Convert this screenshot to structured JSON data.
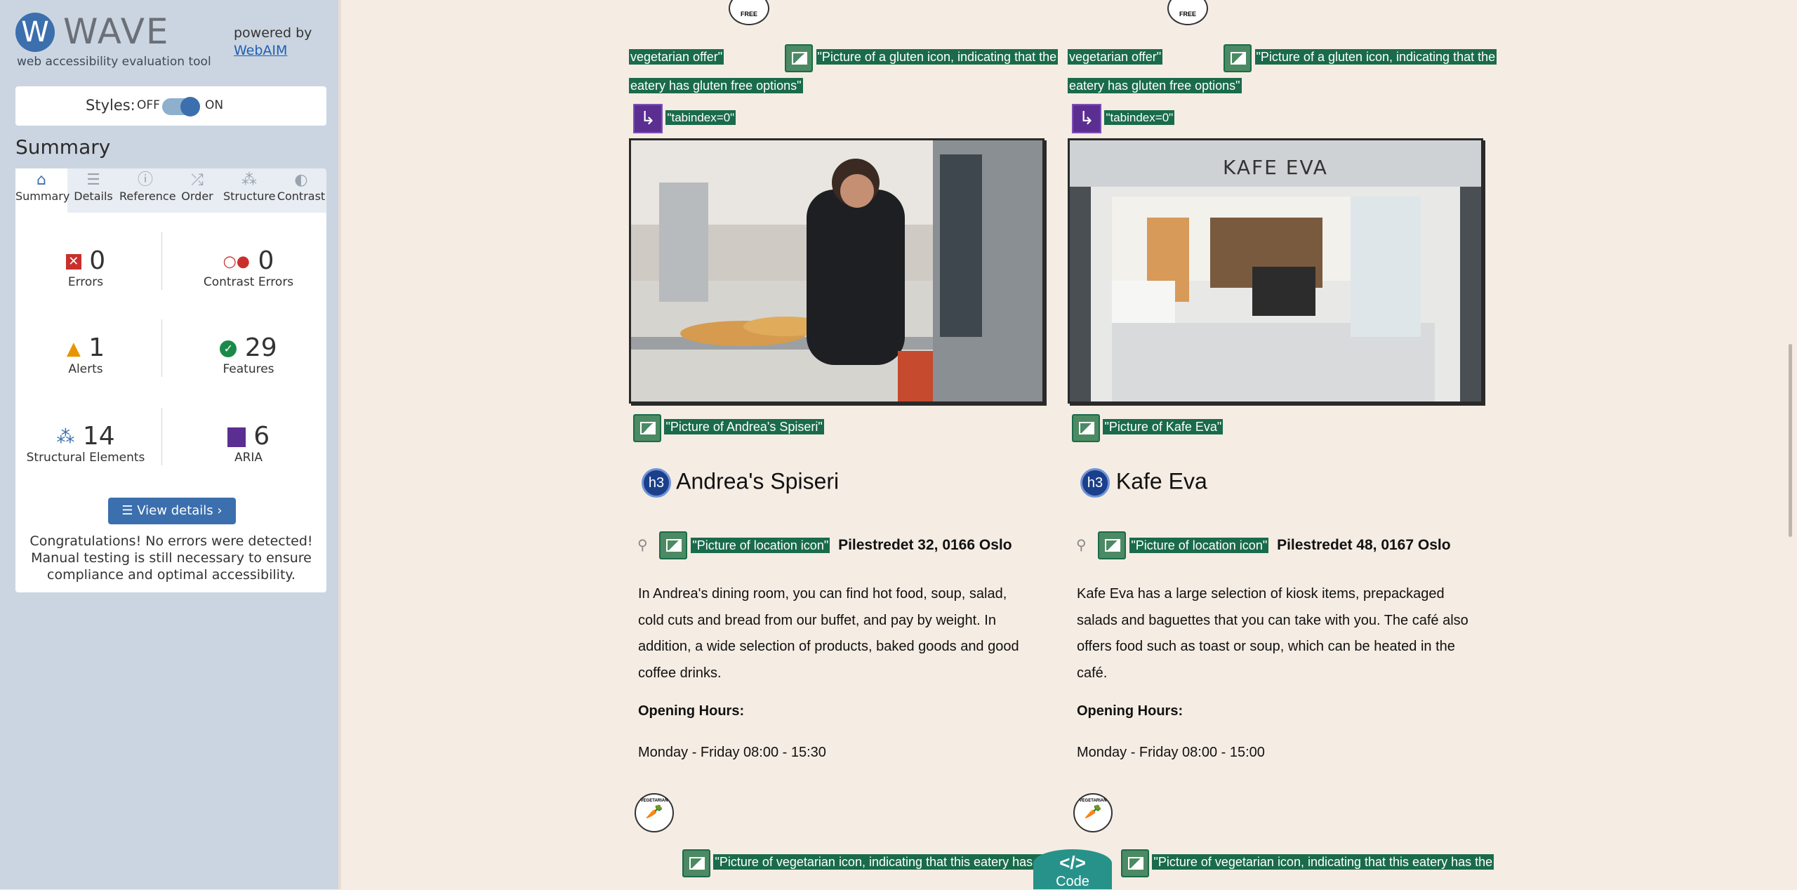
{
  "wave": {
    "logo_letter": "W",
    "title": "WAVE",
    "tagline": "web accessibility evaluation tool",
    "powered_by": "powered by",
    "webaim": "WebAIM",
    "styles_label": "Styles:",
    "styles_off": "OFF",
    "styles_on": "ON",
    "summary_heading": "Summary",
    "tabs": [
      {
        "label": "Summary",
        "icon": "home-icon",
        "glyph": "⌂"
      },
      {
        "label": "Details",
        "icon": "list-icon",
        "glyph": "☰"
      },
      {
        "label": "Reference",
        "icon": "info-icon",
        "glyph": "ⓘ"
      },
      {
        "label": "Order",
        "icon": "order-icon",
        "glyph": "⤮"
      },
      {
        "label": "Structure",
        "icon": "structure-icon",
        "glyph": "⁂"
      },
      {
        "label": "Contrast",
        "icon": "contrast-icon",
        "glyph": "◐"
      }
    ],
    "stats": {
      "errors": {
        "count": "0",
        "label": "Errors"
      },
      "contrast": {
        "count": "0",
        "label": "Contrast Errors"
      },
      "alerts": {
        "count": "1",
        "label": "Alerts"
      },
      "features": {
        "count": "29",
        "label": "Features"
      },
      "structural": {
        "count": "14",
        "label": "Structural Elements"
      },
      "aria": {
        "count": "6",
        "label": "ARIA"
      }
    },
    "view_details": "View details ›",
    "congrats": "Congratulations! No errors were detected! Manual testing is still necessary to ensure compliance and optimal accessibility."
  },
  "colors": {
    "wave_blue": "#3b6fae",
    "feature_green": "#1a6b4b",
    "aria_purple": "#5b2e91",
    "page_bg": "#f5ece3"
  },
  "cards": [
    {
      "veg_offer": "vegetarian offer\"",
      "gluten_alt": "\"Picture of a gluten icon, indicating that the",
      "gluten_alt2": "eatery has gluten free options\"",
      "tabindex": "\"tabindex=0\"",
      "picture_alt": "\"Picture of Andrea's Spiseri\"",
      "heading_tag": "h3",
      "name": "Andrea's Spiseri",
      "location_alt": "\"Picture of location icon\"",
      "address": "Pilestredet 32, 0166 Oslo",
      "description": "In Andrea's dining room, you can find hot food, soup, salad, cold cuts and bread from our buffet, and pay by weight. In addition, a wide selection of products, baked goods and good coffee drinks.",
      "opening_label": "Opening Hours:",
      "hours": "Monday - Friday 08:00 - 15:30",
      "veg_alt": "\"Picture of vegetarian icon, indicating that this eatery has th"
    },
    {
      "veg_offer": "vegetarian offer\"",
      "gluten_alt": "\"Picture of a gluten icon, indicating that the",
      "gluten_alt2": "eatery has gluten free options\"",
      "tabindex": "\"tabindex=0\"",
      "picture_alt": "\"Picture of Kafe Eva\"",
      "heading_tag": "h3",
      "name": "Kafe Eva",
      "location_alt": "\"Picture of location icon\"",
      "address": "Pilestredet 48, 0167 Oslo",
      "description": "Kafe Eva has a large selection of kiosk items, prepackaged salads and baguettes that you can take with you. The café also offers food such as toast or soup, which can be heated in the café.",
      "opening_label": "Opening Hours:",
      "hours": "Monday - Friday 08:00 - 15:00",
      "veg_alt": "\"Picture of vegetarian icon, indicating that this eatery has the"
    }
  ],
  "badges": {
    "free": "FREE",
    "vegetarian": "VEGETARIAN",
    "kafe_sign": "KAFE EVA"
  },
  "code_toggle": {
    "glyph": "</>",
    "label": "Code"
  }
}
